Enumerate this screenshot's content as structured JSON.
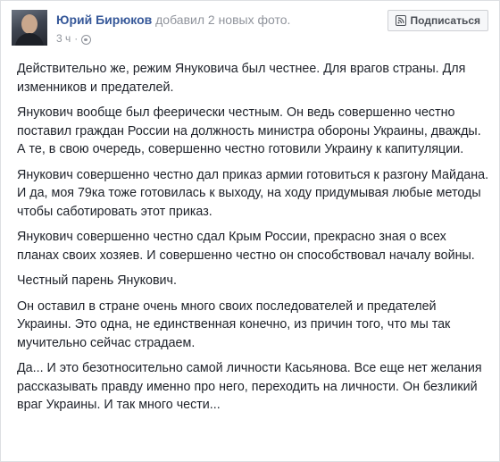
{
  "post": {
    "author": {
      "name": "Юрий Бирюков"
    },
    "action": "добавил 2 новых фото.",
    "time": "3 ч",
    "follow_label": "Подписаться",
    "paragraphs": [
      "Действительно же, режим Януковича был честнее. Для врагов страны. Для изменников и предателей.",
      "Янукович вообще был феерически честным. Он ведь совершенно честно поставил граждан России на должность министра обороны Украины, дважды. А те, в свою очередь, совершенно честно готовили Украину к капитуляции.",
      "Янукович совершенно честно дал приказ армии готовиться к разгону Майдана. И да, моя 79ка тоже готовилась к выходу, на ходу придумывая любые методы чтобы саботировать этот приказ.",
      "Янукович совершенно честно сдал Крым России, прекрасно зная о всех планах своих хозяев. И совершенно честно он способствовал началу войны.",
      "Честный парень Янукович.",
      "Он оставил в стране очень много своих последователей и предателей Украины. Это одна, не единственная конечно, из причин того, что мы так мучительно сейчас страдаем.",
      "Да... И это безотносительно самой личности Касьянова. Все еще нет желания рассказывать правду именно про него, переходить на личности. Он безликий враг Украины. И так много чести..."
    ]
  },
  "icons": {
    "privacy": "globe-icon",
    "follow": "rss-icon"
  },
  "colors": {
    "link": "#365899",
    "meta": "#90949c",
    "text": "#1d2129"
  }
}
